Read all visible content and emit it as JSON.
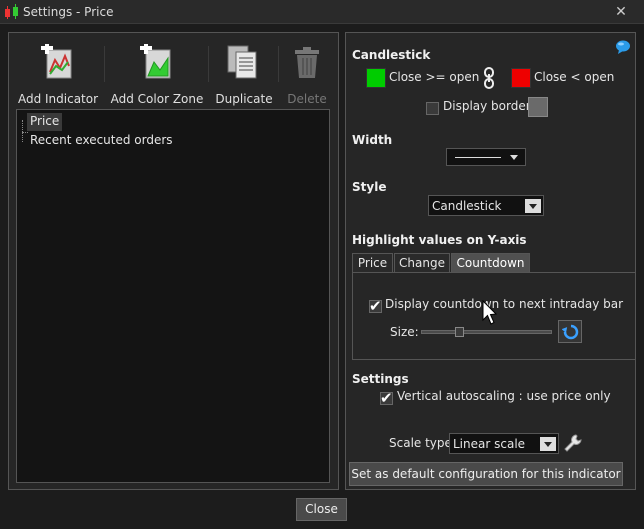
{
  "window": {
    "title": "Settings - Price"
  },
  "toolbar": {
    "add_indicator": "Add Indicator",
    "add_color_zone": "Add Color Zone",
    "duplicate": "Duplicate",
    "delete": "Delete"
  },
  "tree": {
    "items": [
      "Price",
      "Recent executed orders"
    ]
  },
  "candlestick": {
    "heading": "Candlestick",
    "up_label": "Close >= open",
    "down_label": "Close < open",
    "up_color": "#00cc00",
    "down_color": "#ee0000",
    "display_border": "Display border",
    "border_color": "#6a6a6a"
  },
  "width": {
    "heading": "Width"
  },
  "style": {
    "heading": "Style",
    "value": "Candlestick"
  },
  "highlight": {
    "heading": "Highlight values on Y-axis",
    "tabs": [
      "Price",
      "Change",
      "Countdown"
    ],
    "countdown_label": "Display countdown to next intraday bar",
    "size_label": "Size:"
  },
  "settings": {
    "heading": "Settings",
    "autoscaling": "Vertical autoscaling : use price only",
    "scale_type_label": "Scale type",
    "scale_type_value": "Linear scale",
    "set_default": "Set as default configuration for this indicator"
  },
  "footer": {
    "close": "Close"
  }
}
